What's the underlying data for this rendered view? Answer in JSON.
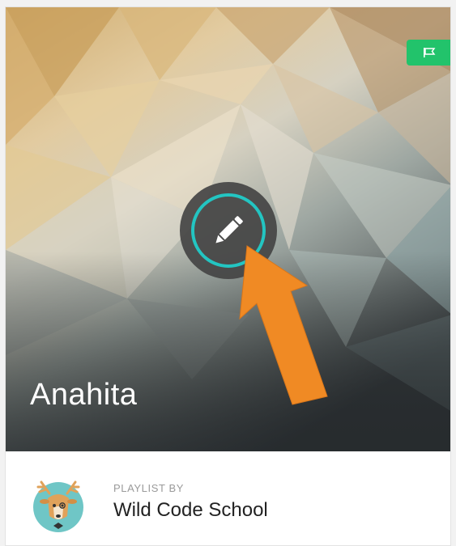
{
  "playlist": {
    "title": "Anahita"
  },
  "owner": {
    "by_label": "PLAYLIST BY",
    "name": "Wild Code School"
  },
  "icons": {
    "badge": "flag-icon",
    "edit": "pencil-icon",
    "annotation": "arrow-icon"
  },
  "colors": {
    "badge": "#22c36b",
    "edit_ring": "#23c5c2",
    "edit_button": "#444444",
    "annotation_arrow": "#f08a24"
  }
}
